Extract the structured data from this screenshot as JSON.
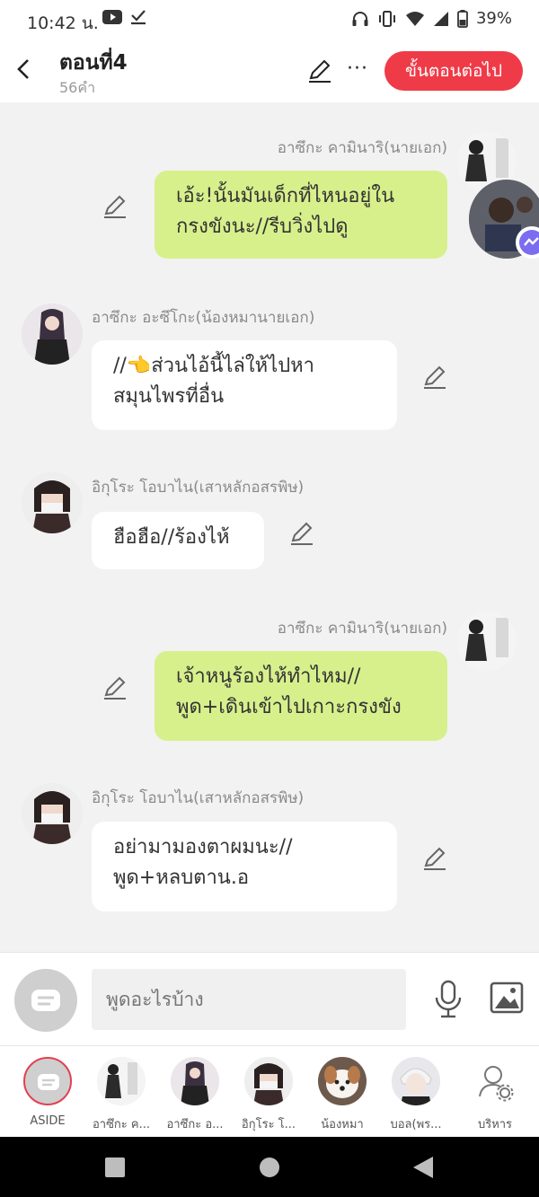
{
  "status_bar": {
    "time": "10:42 น.",
    "battery": "39%",
    "icons_left": [
      "youtube-icon",
      "download-done-icon"
    ],
    "icons_right": [
      "headphones-icon",
      "vibrate-icon",
      "wifi-icon",
      "signal-icon",
      "battery-icon"
    ]
  },
  "header": {
    "title": "ตอนที่4",
    "word_count": "56คำ",
    "next_label": "ขั้นตอนต่อไป",
    "more": "···"
  },
  "messages": [
    {
      "side": "right",
      "name": "อาซึกะ คามินาริ(นายเอก)",
      "text": "เอ้ะ!นั้นมันเด็กที่ไหนอยู่ใน\nกรงขังนะ//รีบวิ่งไปดู"
    },
    {
      "side": "left",
      "name": "อาซึกะ อะซึโกะ(น้องหมานายเอก)",
      "text": "//👈ส่วนไอ้นี้ไล่ให้ไปหา\nสมุนไพรที่อื่น"
    },
    {
      "side": "left",
      "name": "อิกุโระ โอบาไน(เสาหลักอสรพิษ)",
      "text": "ฮือฮือ//ร้องไห้"
    },
    {
      "side": "right",
      "name": "อาซึกะ คามินาริ(นายเอก)",
      "text": "เจ้าหนูร้องไห้ทำไหม//\nพูด+เดินเข้าไปเกาะกรงขัง"
    },
    {
      "side": "left",
      "name": "อิกุโระ โอบาไน(เสาหลักอสรพิษ)",
      "text": "อย่ามามองตาผมนะ//\nพูด+หลบตาน.อ"
    }
  ],
  "input": {
    "placeholder": "พูดอะไรบ้าง"
  },
  "characters": [
    {
      "label": "ASIDE"
    },
    {
      "label": "อาซึกะ ค..."
    },
    {
      "label": "อาซึกะ อ..."
    },
    {
      "label": "อิกุโระ โ..."
    },
    {
      "label": "น้องหมา"
    },
    {
      "label": "บอล(พร..."
    },
    {
      "label": "บริหาร"
    }
  ],
  "colors": {
    "accent": "#ef3b48",
    "bubble_green": "#d7f08c",
    "bubble_white": "#ffffff",
    "background": "#f2f2f2"
  }
}
